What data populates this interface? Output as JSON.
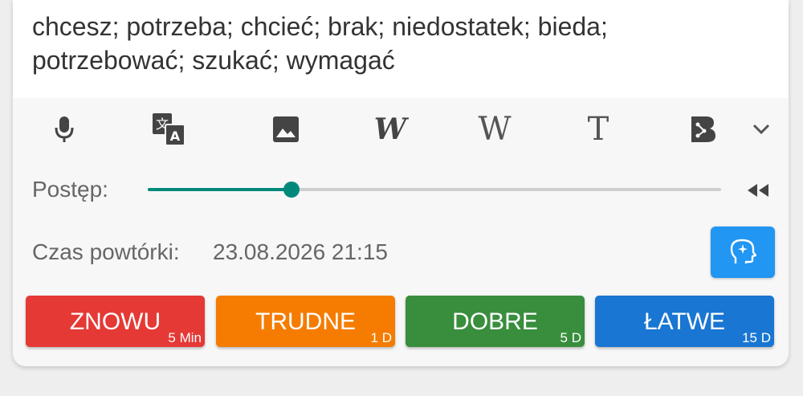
{
  "answer": {
    "line1": "chcesz; potrzeba; chcieć; brak; niedostatek; bieda;",
    "line2": "potrzebować; szukać; wymagać"
  },
  "toolbar": {
    "items": [
      {
        "icon": "microphone-icon"
      },
      {
        "icon": "translate-icon"
      },
      {
        "icon": "image-icon"
      },
      {
        "icon": "w-bold-italic-icon",
        "glyph": "W"
      },
      {
        "icon": "wikipedia-icon",
        "glyph": "W"
      },
      {
        "icon": "text-icon",
        "glyph": "T"
      },
      {
        "icon": "b-network-icon"
      },
      {
        "icon": "chevron-down-icon"
      }
    ]
  },
  "progress": {
    "label": "Postęp:",
    "value": 0.25,
    "color": "#00897b"
  },
  "review": {
    "label": "Czas powtórki:",
    "value": "23.08.2026 21:15",
    "button_icon": "brain-icon",
    "button_color": "#2196f3"
  },
  "buttons": [
    {
      "label": "ZNOWU",
      "time": "5 Min",
      "color": "#e53935"
    },
    {
      "label": "TRUDNE",
      "time": "1 D",
      "color": "#f57c00"
    },
    {
      "label": "DOBRE",
      "time": "5 D",
      "color": "#388e3c"
    },
    {
      "label": "ŁATWE",
      "time": "15 D",
      "color": "#1976d2"
    }
  ]
}
